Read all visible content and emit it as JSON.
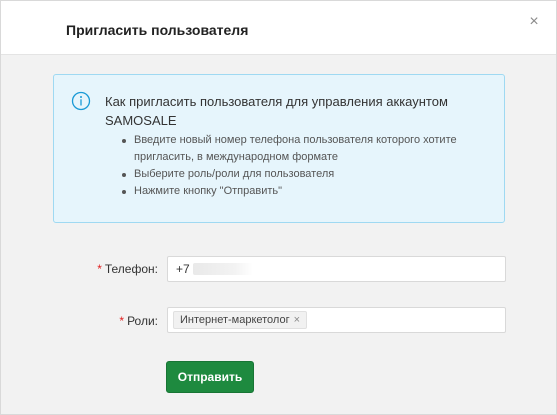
{
  "modal": {
    "title": "Пригласить пользователя",
    "close_symbol": "×"
  },
  "info": {
    "icon": "info-icon",
    "title": "Как пригласить пользователя для управления аккаунтом SAMOSALE",
    "steps": [
      "Введите новый номер телефона пользователя которого хотите пригласить, в международном формате",
      "Выберите роль/роли для пользователя",
      "Нажмите кнопку \"Отправить\""
    ]
  },
  "form": {
    "phone": {
      "label": "Телефон",
      "value": "+7"
    },
    "roles": {
      "label": "Роли",
      "tags": [
        "Интернет-маркетолог"
      ]
    },
    "required_mark": "*",
    "label_colon": ":"
  },
  "actions": {
    "submit_label": "Отправить"
  },
  "colors": {
    "primary": "#1e8a3f",
    "info_bg": "#e6f5fc",
    "info_border": "#9fd9f2",
    "required": "#e02020"
  }
}
